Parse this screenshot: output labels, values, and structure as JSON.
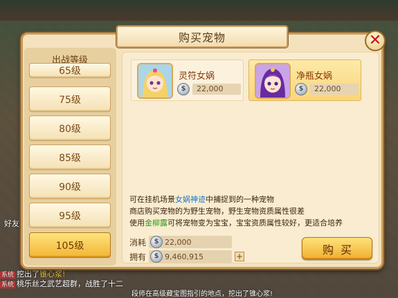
{
  "dialog": {
    "title": "购买宠物"
  },
  "levels": {
    "header": "出战等级",
    "items": [
      {
        "label": "65级",
        "selected": false
      },
      {
        "label": "75级",
        "selected": false
      },
      {
        "label": "80级",
        "selected": false
      },
      {
        "label": "85级",
        "selected": false
      },
      {
        "label": "90级",
        "selected": false
      },
      {
        "label": "95级",
        "selected": false
      },
      {
        "label": "105级",
        "selected": true
      }
    ]
  },
  "pets": [
    {
      "name": "灵符女娲",
      "price": "22,000",
      "selected": false
    },
    {
      "name": "净瓶女娲",
      "price": "22,000",
      "selected": true
    }
  ],
  "description": {
    "line1_pre": "可在挂机场景",
    "line1_link": "女娲神迹",
    "line1_post": "中捕捉到的一种宠物",
    "line2": "商店购买宠物的为野生宠物，野生宠物资质属性很差",
    "line3_pre": "使用",
    "line3_item": "金柳露",
    "line3_post": "可将宠物变为宝宝，宝宝资质属性较好，更适合培养"
  },
  "cost": {
    "label": "消耗",
    "value": "22,000"
  },
  "owned": {
    "label": "拥有",
    "value": "9,460,915"
  },
  "buy_button": "购买",
  "world": {
    "chat1_tag": "系统",
    "chat1_pre": "挖出了",
    "chat1_link": "锥心浆!",
    "chat2_tag": "系统",
    "chat2_text": "桃乐丝之武艺超群，战胜了十二",
    "bottom": "段师在高级藏宝图指引的地点，挖出了锥心浆!",
    "side_text": "好友"
  },
  "colors": {
    "accent": "#f2b636",
    "panel": "#f3e2bd",
    "link_blue": "#1a78c8",
    "item_green": "#2a9a14",
    "close_red": "#c8101a"
  }
}
